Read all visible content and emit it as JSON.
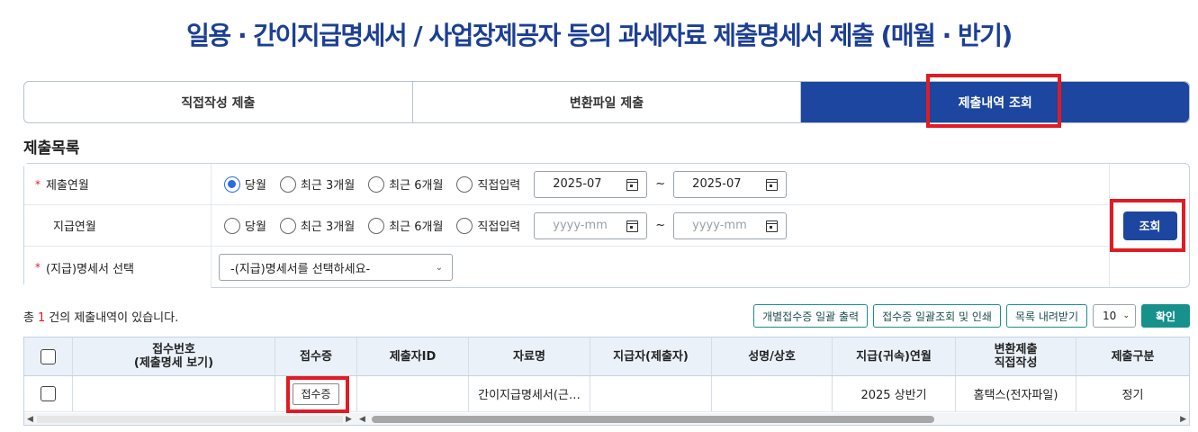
{
  "page_title": "일용 · 간이지급명세서 / 사업장제공자 등의 과세자료 제출명세서 제출 (매월 · 반기)",
  "tabs": [
    {
      "label": "직접작성 제출"
    },
    {
      "label": "변환파일 제출"
    },
    {
      "label": "제출내역 조회"
    }
  ],
  "section_title": "제출목록",
  "filters": {
    "submit_month": {
      "label": "제출연월",
      "required": "*",
      "options": [
        "당월",
        "최근 3개월",
        "최근 6개월",
        "직접입력"
      ],
      "selected": "당월",
      "from": "2025-07",
      "to": "2025-07"
    },
    "pay_month": {
      "label": "지급연월",
      "options": [
        "당월",
        "최근 3개월",
        "최근 6개월",
        "직접입력"
      ],
      "from_placeholder": "yyyy-mm",
      "to_placeholder": "yyyy-mm"
    },
    "statement": {
      "label": "(지급)명세서 선택",
      "required": "*",
      "value": "-(지급)명세서를 선택하세요-"
    },
    "tilde": "~",
    "search_button": "조회"
  },
  "result": {
    "prefix": "총",
    "count": "1",
    "suffix": "건의 제출내역이 있습니다."
  },
  "toolbar": {
    "btn_individual_print": "개별접수증 일괄 출력",
    "btn_bulk_view_print": "접수증 일괄조회 및 인쇄",
    "btn_download": "목록 내려받기",
    "page_size": "10",
    "btn_confirm": "확인"
  },
  "table": {
    "headers": {
      "receipt_no_line1": "접수번호",
      "receipt_no_line2": "(제출명세 보기)",
      "receipt": "접수증",
      "submitter_id": "제출자ID",
      "data_name": "자료명",
      "payer": "지급자(제출자)",
      "name": "성명/상호",
      "pay_month": "지급(귀속)연월",
      "method_line1": "변환제출",
      "method_line2": "직접작성",
      "submit_type": "제출구분"
    },
    "rows": [
      {
        "receipt_no": "",
        "receipt_button": "접수증",
        "submitter_id": "",
        "data_name": "간이지급명세서(근…",
        "payer": "",
        "name": "",
        "pay_month": "2025 상반기",
        "method": "홈택스(전자파일)",
        "submit_type": "정기"
      }
    ]
  },
  "colors": {
    "primary": "#1c46a0",
    "teal": "#17918b",
    "highlight": "#e01b24"
  }
}
